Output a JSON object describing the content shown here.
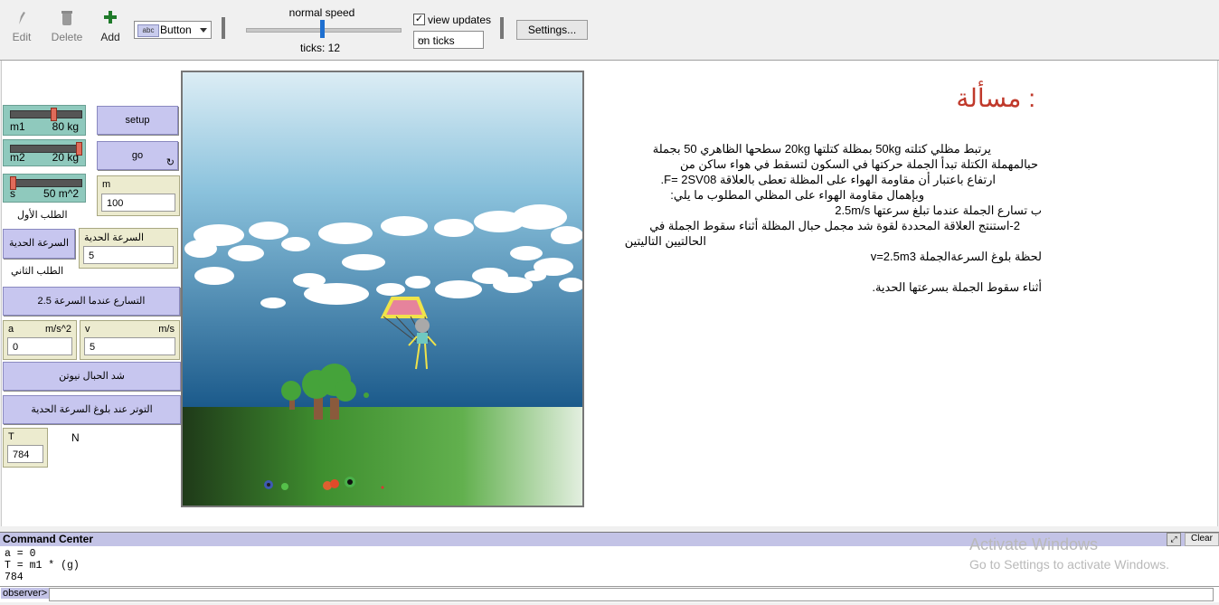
{
  "toolbar": {
    "edit_label": "Edit",
    "delete_label": "Delete",
    "add_label": "Add",
    "widget_type": "Button",
    "speed_label": "normal speed",
    "speed_fraction": 0.5,
    "ticks_label": "ticks: 12",
    "view_updates_label": "view updates",
    "view_updates_checked": true,
    "update_mode": "on ticks",
    "settings_label": "Settings..."
  },
  "interface": {
    "sliders": [
      {
        "name": "m1",
        "value": "80 kg",
        "fraction": 0.62
      },
      {
        "name": "m2",
        "value": "20 kg",
        "fraction": 1.0
      },
      {
        "name": "s",
        "value": "50 m^2",
        "fraction": 0.0
      }
    ],
    "buttons": {
      "setup": "setup",
      "go": "go",
      "terminal_velocity": "السرعة الحدية",
      "accel_at_2_5": "التسارع عندما السرعة 2.5",
      "rope_tension": "شد الحبال نيوتن",
      "tension_at_terminal": "التوتر عند بلوغ السرعة الحدية"
    },
    "notes": {
      "first_request": "الطلب الأول",
      "second_request": "الطلب الثاني",
      "newton_unit": "N"
    },
    "inputs": {
      "m": {
        "name": "m",
        "value": "100"
      },
      "terminal_speed": {
        "name": "السرعة الحدية",
        "value": "5"
      },
      "a": {
        "name": "a",
        "unit": "m/s^2",
        "value": "0"
      },
      "v": {
        "name": "v",
        "unit": "m/s",
        "value": "5"
      },
      "T": {
        "name": "T",
        "value": "784"
      }
    },
    "problem": {
      "title": "مسألة :",
      "lines": [
        "يرتبط مظلي كتلته 50kg بمظلة كتلتها 20kg سطحها الظاهري 50 بجملة",
        "حبالمهملة الكتلة تبدأ الجملة حركتها في السكون لتسقط في هواء ساكن من",
        "ارتفاع باعتبار أن مقاومة الهواء على المظلة تعطى بالعلاقة F= 2SV08.",
        "وبإهمال مقاومة الهواء على المظلي المطلوب ما يلي:",
        "ب تسارع الجملة عندما تبلغ سرعتها 2.5m/s",
        "2-استنتج العلاقة المحددة لقوة شد مجمل حبال المظلة أثناء سقوط الجملة في",
        "الحالتيين التاليتين",
        "لحظة بلوغ السرعةالجملة v=2.5m3",
        "أثناء سقوط الجملة بسرعتها الحدية."
      ]
    }
  },
  "command_center": {
    "title": "Command Center",
    "clear_label": "Clear",
    "output": [
      "a = 0",
      "T = m1 * (g)",
      "784"
    ],
    "prompt": "observer>"
  },
  "watermark": {
    "line1": "Activate Windows",
    "line2": "Go to Settings to activate Windows."
  },
  "colors": {
    "slider_green": "#8fc9bd",
    "button_purple": "#c7c6ef",
    "input_beige": "#ecebcf",
    "title_red": "#c0392b",
    "sky_top": "#d8ebf4",
    "sky_bottom": "#1e5f91",
    "grass": "#3f8f2f"
  }
}
